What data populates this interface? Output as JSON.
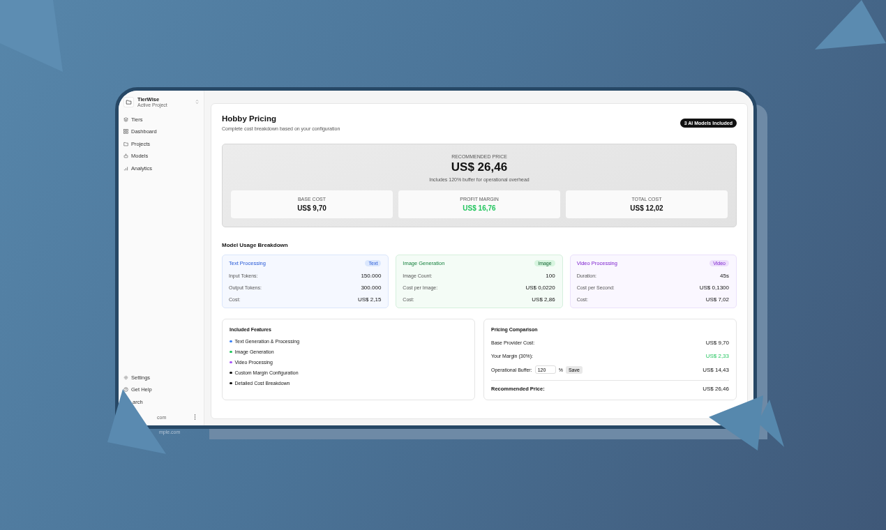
{
  "sidebar": {
    "workspace": {
      "name": "TierWise",
      "subtitle": "Active Project"
    },
    "nav": [
      {
        "label": "Tiers"
      },
      {
        "label": "Dashboard"
      },
      {
        "label": "Projects"
      },
      {
        "label": "Models"
      },
      {
        "label": "Analytics"
      }
    ],
    "footer": [
      {
        "label": "Settings"
      },
      {
        "label": "Get Help"
      },
      {
        "label": "arch"
      }
    ],
    "user_email": "com",
    "reflection_text": "mple.com"
  },
  "header": {
    "title": "Hobby Pricing",
    "subtitle": "Complete cost breakdown based on your configuration",
    "badge": "3 AI Models Included"
  },
  "recommended": {
    "label": "RECOMMENDED PRICE",
    "price": "US$ 26,46",
    "note": "Includes 120% buffer for operational overhead",
    "stats": [
      {
        "label": "BASE COST",
        "value": "US$ 9,70",
        "positive": false
      },
      {
        "label": "PROFIT MARGIN",
        "value": "US$ 16,76",
        "positive": true
      },
      {
        "label": "TOTAL COST",
        "value": "US$ 12,02",
        "positive": false
      }
    ]
  },
  "models_heading": "Model Usage Breakdown",
  "models": [
    {
      "kind": "text",
      "title": "Text Processing",
      "tag": "Text",
      "rows": [
        {
          "label": "Input Tokens:",
          "value": "150.000"
        },
        {
          "label": "Output Tokens:",
          "value": "300.000"
        },
        {
          "label": "Cost:",
          "value": "US$ 2,15"
        }
      ]
    },
    {
      "kind": "image",
      "title": "Image Generation",
      "tag": "Image",
      "rows": [
        {
          "label": "Image Count:",
          "value": "100"
        },
        {
          "label": "Cost per Image:",
          "value": "US$ 0,0220"
        },
        {
          "label": "Cost:",
          "value": "US$ 2,86"
        }
      ]
    },
    {
      "kind": "video",
      "title": "Video Processing",
      "tag": "Video",
      "rows": [
        {
          "label": "Duration:",
          "value": "45s"
        },
        {
          "label": "Cost per Second:",
          "value": "US$ 0,1300"
        },
        {
          "label": "Cost:",
          "value": "US$ 7,02"
        }
      ]
    }
  ],
  "features": {
    "title": "Included Features",
    "items": [
      {
        "label": "Text Generation & Processing",
        "color": "#3b82f6"
      },
      {
        "label": "Image Generation",
        "color": "#22c55e"
      },
      {
        "label": "Video Processing",
        "color": "#a855f7"
      },
      {
        "label": "Custom Margin Configuration",
        "color": "#111111"
      },
      {
        "label": "Detailed Cost Breakdown",
        "color": "#111111"
      }
    ]
  },
  "comparison": {
    "title": "Pricing Comparison",
    "rows": [
      {
        "kind": "value",
        "label": "Base Provider Cost:",
        "value": "US$ 9,70",
        "positive": false
      },
      {
        "kind": "value",
        "label": "Your Margin (30%):",
        "value": "US$ 2,33",
        "positive": true
      },
      {
        "kind": "input",
        "label": "Operational Buffer:",
        "input": "120",
        "unit": "%",
        "button": "Save",
        "value": "US$ 14,43",
        "positive": false
      },
      {
        "kind": "total",
        "label": "Recommended Price:",
        "value": "US$ 26,46",
        "positive": false
      }
    ]
  }
}
